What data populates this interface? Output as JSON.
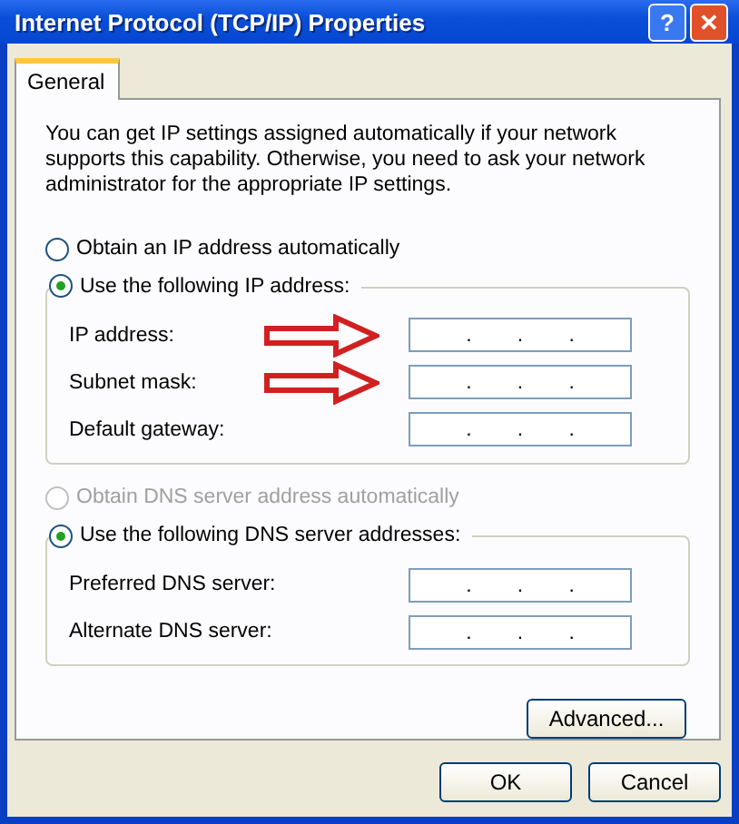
{
  "window": {
    "title": "Internet Protocol (TCP/IP) Properties",
    "buttons": [
      {
        "kind": "help",
        "label": "?"
      },
      {
        "kind": "close",
        "label": "✕"
      }
    ]
  },
  "tabs": [
    {
      "label": "General",
      "selected": true
    }
  ],
  "description": "You can get IP settings assigned automatically if your network supports this capability. Otherwise, you need to ask your network administrator for the appropriate IP settings.",
  "ip_options": [
    {
      "label": "Obtain an IP address automatically",
      "selected": false,
      "disabled": false
    },
    {
      "label": "Use the following IP address:",
      "selected": true,
      "disabled": false,
      "fields": [
        {
          "label": "IP address:",
          "separators": [
            ".",
            ".",
            "."
          ],
          "arrow": true,
          "disabled": false
        },
        {
          "label": "Subnet mask:",
          "separators": [
            ".",
            ".",
            "."
          ],
          "arrow": true,
          "disabled": false
        },
        {
          "label": "Default gateway:",
          "separators": [
            ".",
            ".",
            "."
          ],
          "arrow": false,
          "disabled": false
        }
      ]
    }
  ],
  "dns_options": [
    {
      "label": "Obtain DNS server address automatically",
      "selected": false,
      "disabled": true
    },
    {
      "label": "Use the following DNS server addresses:",
      "selected": true,
      "disabled": false,
      "fields": [
        {
          "label": "Preferred DNS server:",
          "separators": [
            ".",
            ".",
            "."
          ],
          "arrow": false,
          "disabled": false
        },
        {
          "label": "Alternate DNS server:",
          "separators": [
            ".",
            ".",
            "."
          ],
          "arrow": false,
          "disabled": false
        }
      ]
    }
  ],
  "advanced_button": "Advanced...",
  "buttons": [
    "OK",
    "Cancel"
  ]
}
